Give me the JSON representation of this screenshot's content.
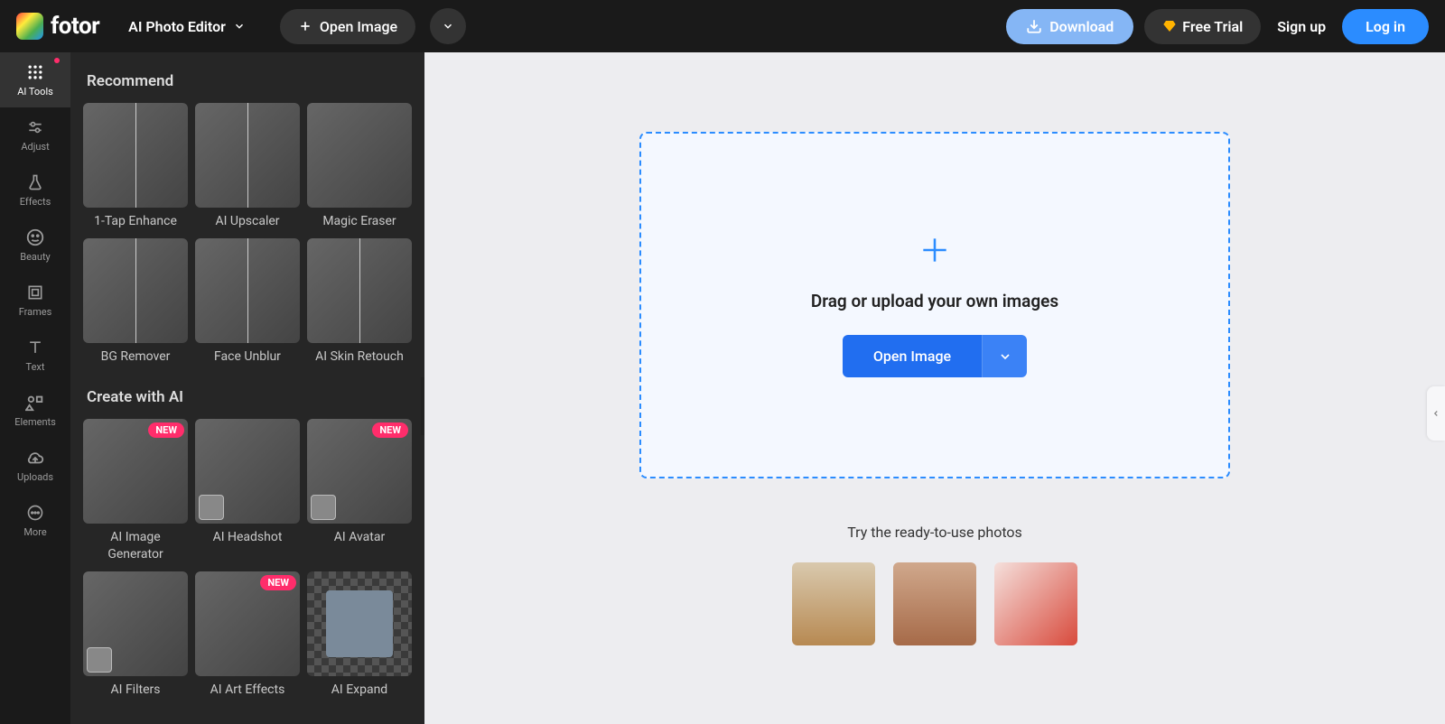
{
  "header": {
    "brand": "fotor",
    "editor_label": "AI Photo Editor",
    "open_image": "Open Image",
    "download": "Download",
    "free_trial": "Free Trial",
    "sign_up": "Sign up",
    "log_in": "Log in"
  },
  "rail": [
    {
      "label": "AI Tools",
      "icon": "grid-icon",
      "active": true,
      "dot": true
    },
    {
      "label": "Adjust",
      "icon": "sliders-icon"
    },
    {
      "label": "Effects",
      "icon": "flask-icon"
    },
    {
      "label": "Beauty",
      "icon": "face-icon"
    },
    {
      "label": "Frames",
      "icon": "frame-icon"
    },
    {
      "label": "Text",
      "icon": "text-icon"
    },
    {
      "label": "Elements",
      "icon": "shapes-icon"
    },
    {
      "label": "Uploads",
      "icon": "cloud-icon"
    },
    {
      "label": "More",
      "icon": "more-icon"
    }
  ],
  "panel": {
    "sections": [
      {
        "title": "Recommend",
        "items": [
          {
            "label": "1-Tap Enhance",
            "thumb": "split"
          },
          {
            "label": "AI Upscaler",
            "thumb": "split"
          },
          {
            "label": "Magic Eraser",
            "thumb": "plain"
          },
          {
            "label": "BG Remover",
            "thumb": "split"
          },
          {
            "label": "Face Unblur",
            "thumb": "split"
          },
          {
            "label": "AI Skin Retouch",
            "thumb": "split"
          }
        ]
      },
      {
        "title": "Create with AI",
        "items": [
          {
            "label": "AI Image Generator",
            "thumb": "plain",
            "badge": "NEW"
          },
          {
            "label": "AI Headshot",
            "thumb": "plain",
            "mini": true
          },
          {
            "label": "AI Avatar",
            "thumb": "plain",
            "badge": "NEW",
            "mini": true
          },
          {
            "label": "AI Filters",
            "thumb": "plain",
            "mini": true
          },
          {
            "label": "AI Art Effects",
            "thumb": "plain",
            "badge": "NEW"
          },
          {
            "label": "AI Expand",
            "thumb": "checker"
          }
        ]
      }
    ]
  },
  "main": {
    "drop_text": "Drag or upload your own images",
    "open_image": "Open Image",
    "try_label": "Try the ready-to-use photos",
    "samples": [
      "sample-1",
      "sample-2",
      "sample-3"
    ]
  }
}
